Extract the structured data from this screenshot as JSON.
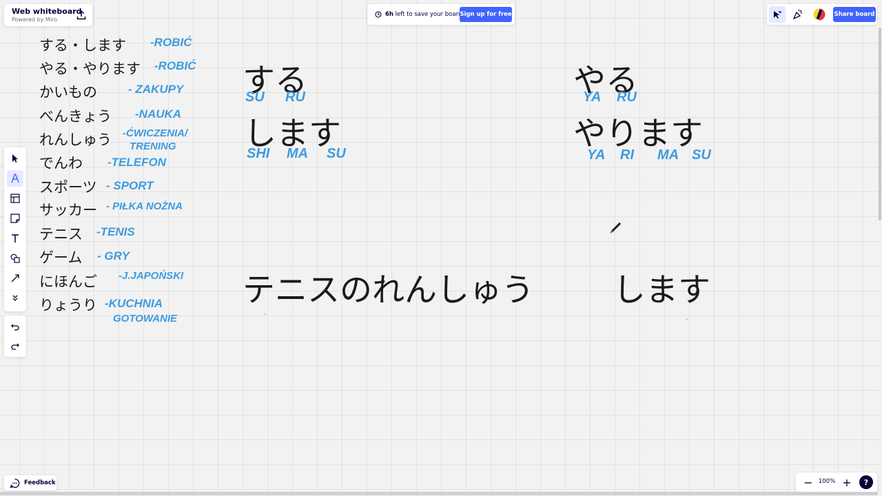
{
  "app": {
    "board_title": "Web whiteboard",
    "powered_by": "Powered by Miro"
  },
  "save_notice": {
    "hours": "6h",
    "text": " left to save your board.",
    "signup_label": "Sign up for free"
  },
  "top_right": {
    "share_label": "Share board"
  },
  "toolbar": {
    "tools": [
      "select-tool",
      "pen-tool",
      "table-tool",
      "sticky-note-tool",
      "text-tool",
      "shapes-tool",
      "connector-tool",
      "more-tools"
    ],
    "active_tool": "pen-tool"
  },
  "bottom": {
    "feedback_label": "Feedback",
    "zoom_level": "100%",
    "zoom_out": "−",
    "zoom_in": "+",
    "help": "?"
  },
  "vocab": [
    {
      "jp": "する・します",
      "pl": "-ROBIĆ"
    },
    {
      "jp": "やる・やります",
      "pl": "-ROBIĆ"
    },
    {
      "jp": "かいもの",
      "pl": "- ZAKUPY"
    },
    {
      "jp": "べんきょう",
      "pl": "-NAUKA"
    },
    {
      "jp": "れんしゅう",
      "pl": "-ĆWICZENIA/",
      "pl2": "TRENING"
    },
    {
      "jp": "でんわ",
      "pl": "-TELEFON"
    },
    {
      "jp": "スポーツ",
      "pl": "- SPORT"
    },
    {
      "jp": "サッカー",
      "pl": "- PIŁKA NOŻNA"
    },
    {
      "jp": "テニス",
      "pl": "-TENIS"
    },
    {
      "jp": "ゲーム",
      "pl": "- GRY"
    },
    {
      "jp": "にほんご",
      "pl": "-J.JAPOŃSKI"
    },
    {
      "jp": "りょうり",
      "pl": "-KUCHNIA",
      "pl2": "GOTOWANIE"
    }
  ],
  "lessons": {
    "suru": {
      "word": "する",
      "romaji": [
        "SU",
        "RU"
      ]
    },
    "shimasu": {
      "word": "します",
      "romaji": [
        "SHI",
        "MA",
        "SU"
      ]
    },
    "yaru": {
      "word": "やる",
      "romaji": [
        "YA",
        "RU"
      ]
    },
    "yarimasu": {
      "word": "やります",
      "romaji": [
        "YA",
        "RI",
        "MA",
        "SU"
      ]
    },
    "sentence": {
      "part1": "テニスのれんしゅう",
      "part2": "します"
    }
  },
  "colors": {
    "accent": "#4262ff",
    "handwriting": "#3d9be0",
    "ink": "#1a1a1a",
    "canvas": "#f2f2f2"
  }
}
